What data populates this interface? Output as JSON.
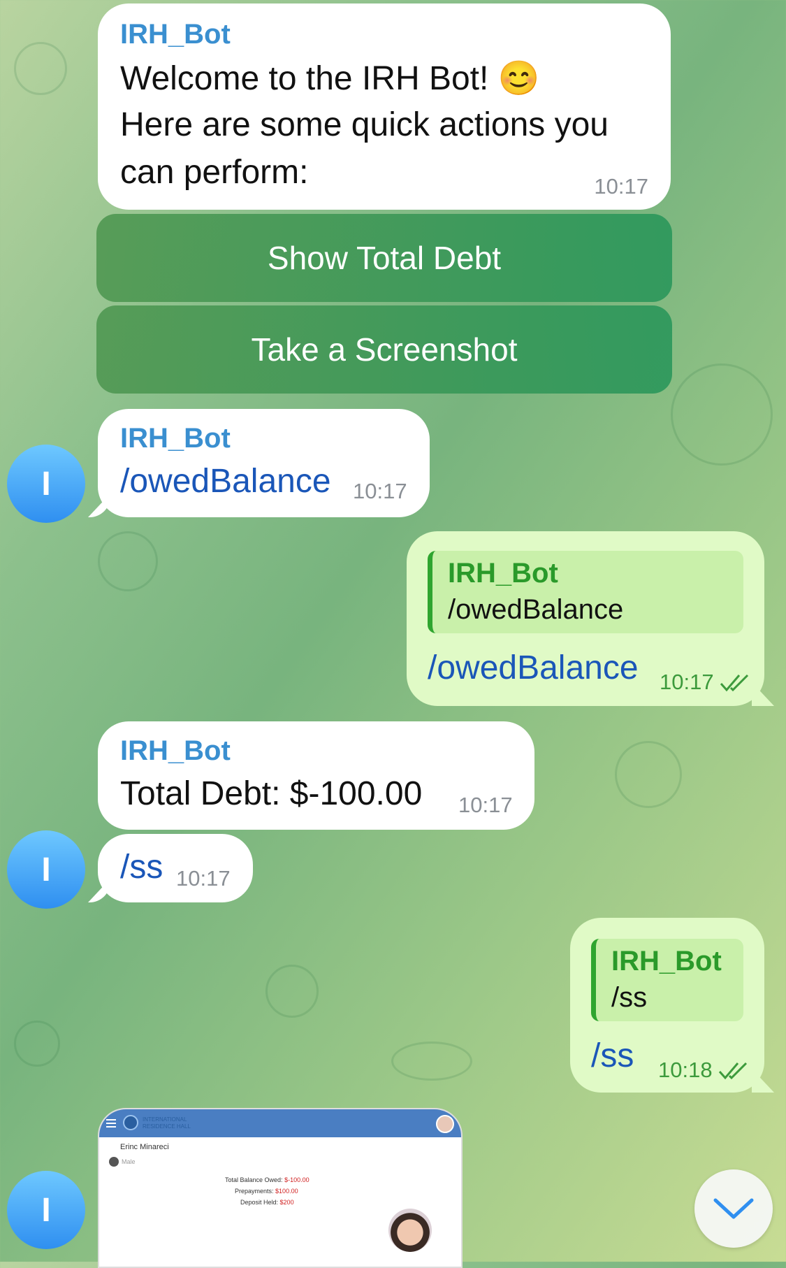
{
  "messages": {
    "welcome": {
      "sender": "IRH_Bot",
      "line1": "Welcome to the IRH Bot! 😊",
      "line2": "Here are some quick actions you",
      "line3": "can perform:",
      "time": "10:17"
    },
    "keyboard": {
      "show_total_debt": "Show Total Debt",
      "take_screenshot": "Take a Screenshot"
    },
    "owed_cmd_in": {
      "sender": "IRH_Bot",
      "text": "/owedBalance",
      "time": "10:17",
      "avatar_letter": "I"
    },
    "owed_cmd_out": {
      "reply_sender": "IRH_Bot",
      "reply_text": "/owedBalance",
      "text": "/owedBalance",
      "time": "10:17"
    },
    "debt_reply": {
      "sender": "IRH_Bot",
      "text": "Total Debt: $-100.00",
      "time": "10:17"
    },
    "ss_in": {
      "text": "/ss",
      "time": "10:17",
      "avatar_letter": "I"
    },
    "ss_out": {
      "reply_sender": "IRH_Bot",
      "reply_text": "/ss",
      "text": "/ss",
      "time": "10:18"
    },
    "screenshot": {
      "avatar_letter": "I",
      "logo_line1": "INTERNATIONAL",
      "logo_line2": "RESIDENCE HALL",
      "name": "Erinc Minareci",
      "gender": "Male",
      "balance_label": "Total Balance Owed:",
      "balance_value": "$-100.00",
      "prepay_label": "Prepayments:",
      "prepay_value": "$100.00",
      "deposit_label": "Deposit Held:",
      "deposit_value": "$200"
    }
  },
  "colors": {
    "incoming_bubble": "#ffffff",
    "outgoing_bubble": "#e0fac6",
    "sender_name": "#3a8fd0",
    "command_link": "#1a56b8",
    "avatar": "#2f8ff0"
  },
  "icons": [
    "double-check-icon",
    "chevron-down-icon"
  ]
}
